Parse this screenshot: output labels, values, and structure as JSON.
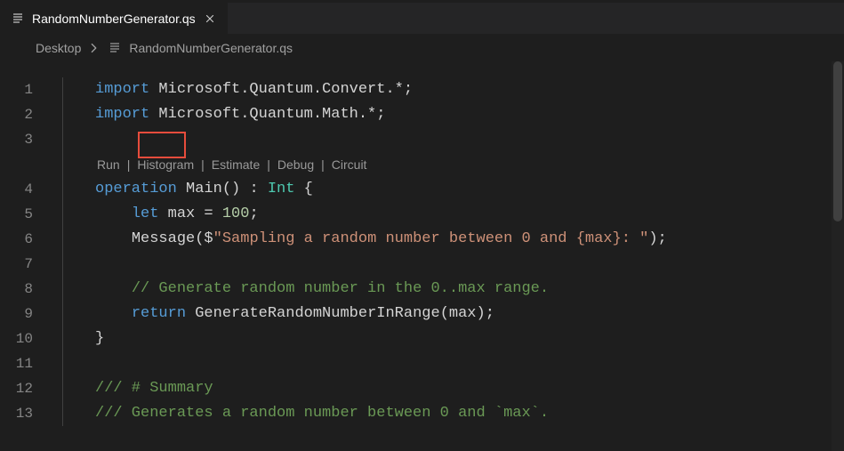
{
  "tab": {
    "filename": "RandomNumberGenerator.qs",
    "icon": "file-lines-icon"
  },
  "breadcrumb": {
    "segments": [
      "Desktop",
      "RandomNumberGenerator.qs"
    ]
  },
  "codelens": {
    "items": [
      "Run",
      "Histogram",
      "Estimate",
      "Debug",
      "Circuit"
    ],
    "highlighted": "Run"
  },
  "line_numbers": [
    "1",
    "2",
    "3",
    "4",
    "5",
    "6",
    "7",
    "8",
    "9",
    "10",
    "11",
    "12",
    "13"
  ],
  "code": {
    "l1": {
      "kw": "import",
      "rest": " Microsoft.Quantum.Convert.*;"
    },
    "l2": {
      "kw": "import",
      "rest": " Microsoft.Quantum.Math.*;"
    },
    "l4": {
      "kw": "operation",
      "name": " Main",
      "sig1": "()",
      "sig2": " : ",
      "ty": "Int",
      "brace": " {"
    },
    "l5": {
      "indent": "    ",
      "kw": "let",
      "var": " max",
      "eq": " = ",
      "num": "100",
      "semi": ";"
    },
    "l6": {
      "indent": "    ",
      "fn": "Message",
      "open": "($",
      "str": "\"Sampling a random number between 0 and {max}: \"",
      "close": ");"
    },
    "l8": {
      "indent": "    ",
      "cmt": "// Generate random number in the 0..max range."
    },
    "l9": {
      "indent": "    ",
      "kw": "return",
      "sp": " ",
      "fn": "GenerateRandomNumberInRange",
      "args": "(max);"
    },
    "l10": {
      "brace": "}"
    },
    "l12": {
      "cmt": "/// # Summary"
    },
    "l13": {
      "cmt": "/// Generates a random number between 0 and `max`."
    }
  }
}
